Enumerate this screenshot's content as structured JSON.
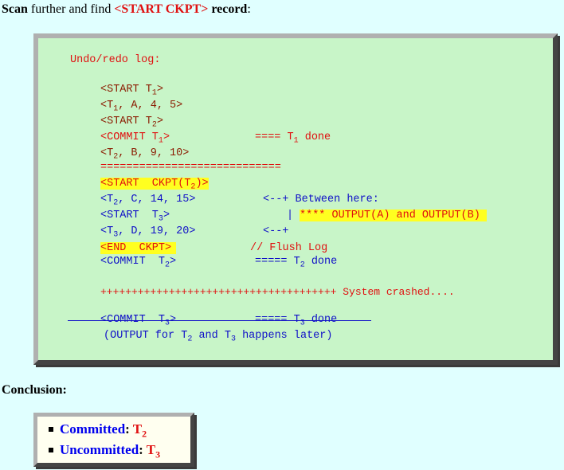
{
  "heading": {
    "prefix": "Scan",
    "middle": " further and find ",
    "record_tag": "<START CKPT>",
    "suffix": " record",
    "colon": ":"
  },
  "log": {
    "title": "Undo/redo log:",
    "line1_a": "<START T",
    "line1_sub": "1",
    "line1_b": ">",
    "line2_a": "<T",
    "line2_sub": "1",
    "line2_b": ", A, 4, 5>",
    "line3_a": "<START T",
    "line3_sub": "2",
    "line3_b": ">",
    "line4_a": "<COMMIT T",
    "line4_sub": "1",
    "line4_b": ">",
    "line4_note_a": "==== T",
    "line4_note_sub": "1",
    "line4_note_b": " done",
    "line5_a": "<T",
    "line5_sub": "2",
    "line5_b": ", B, 9, 10>",
    "separator": "============================",
    "ckpt_a": "<START  CKPT(T",
    "ckpt_sub": "2",
    "ckpt_b": ")>",
    "line7_a": "<T",
    "line7_sub": "2",
    "line7_b": ", C, 14, 15>",
    "arrow1": "<--+ Between here:",
    "line8_a": "<START  T",
    "line8_sub": "3",
    "line8_b": ">",
    "pipe": "|",
    "output_note": "**** OUTPUT(A) and OUTPUT(B)",
    "line9_a": "<T",
    "line9_sub": "3",
    "line9_b": ", D, 19, 20>",
    "arrow2": "<--+",
    "end_ckpt": "<END  CKPT>",
    "flush": "// Flush Log",
    "line11_a": "<COMMIT  T",
    "line11_sub": "2",
    "line11_b": ">",
    "line11_note_a": "===== T",
    "line11_note_sub": "2",
    "line11_note_b": " done",
    "crash_plus": "++++++++++++++++++++++++++++++++++++++",
    "crash_text": " System crashed....",
    "line13_a": "<COMMIT  T",
    "line13_sub": "3",
    "line13_b": ">",
    "line13_note_a": "===== T",
    "line13_note_sub": "3",
    "line13_note_b": " done",
    "output_later_a": "(OUTPUT for T",
    "output_later_sub1": "2",
    "output_later_mid": " and T",
    "output_later_sub2": "3",
    "output_later_b": " happens later)"
  },
  "conclusion": {
    "label": "Conclusion:",
    "items": [
      {
        "label": "Committed",
        "colon": ": ",
        "value": "T",
        "value_sub": "2"
      },
      {
        "label": "Uncommitted",
        "colon": ": ",
        "value": "T",
        "value_sub": "3"
      }
    ]
  },
  "colors": {
    "background": "#e0ffff",
    "log_box": "#c8f5c8",
    "highlight": "#ffff20",
    "red": "#e01010",
    "dark_red": "#8b1a00",
    "blue": "#1010c8"
  }
}
